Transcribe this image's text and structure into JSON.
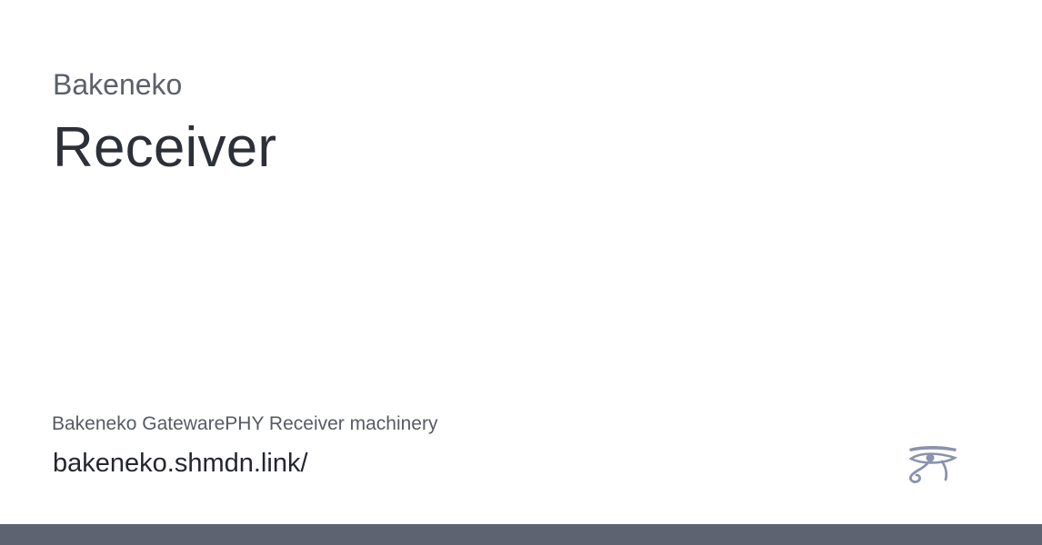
{
  "card": {
    "eyebrow": "Bakeneko",
    "title": "Receiver",
    "description": "Bakeneko GatewarePHY Receiver machinery",
    "url": "bakeneko.shmdn.link/",
    "logo_icon": "eye-of-horus-icon"
  },
  "colors": {
    "footer_bar": "#5d6370",
    "logo": "#8a92ad"
  }
}
